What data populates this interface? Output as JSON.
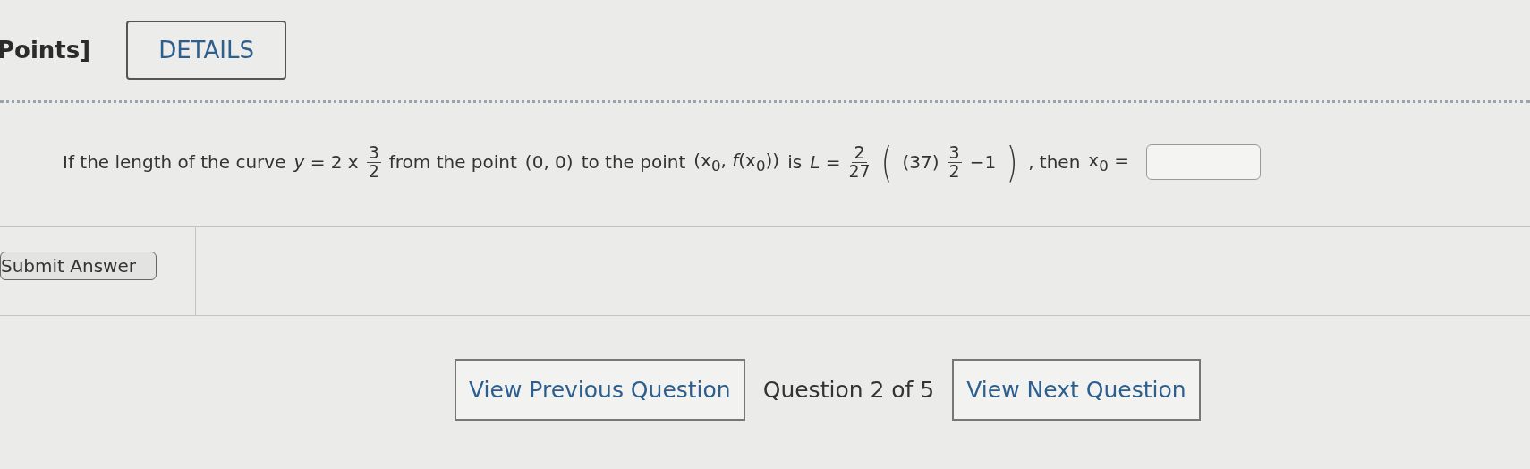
{
  "header": {
    "points_label": "Points]",
    "details_button": "DETAILS"
  },
  "question": [
    {
      "kind": "text",
      "text": "If the length of the curve"
    },
    {
      "kind": "math",
      "text": "*y* =  2 x"
    },
    {
      "kind": "frac",
      "num": "3",
      "den": "2"
    },
    {
      "kind": "text",
      "text": "from the point"
    },
    {
      "kind": "math",
      "text": "(0, 0)"
    },
    {
      "kind": "text",
      "text": "to the point"
    },
    {
      "kind": "math",
      "text": "(x$_{0}$, *f*(x$_{0}$))"
    },
    {
      "kind": "text",
      "text": "is"
    },
    {
      "kind": "math",
      "text": "*L* ="
    },
    {
      "kind": "frac",
      "num": "2",
      "den": "27"
    },
    {
      "kind": "paren",
      "text": "("
    },
    {
      "kind": "math",
      "text": "(37)"
    },
    {
      "kind": "frac",
      "num": "3",
      "den": "2"
    },
    {
      "kind": "math",
      "text": "−1"
    },
    {
      "kind": "paren",
      "text": ")"
    },
    {
      "kind": "text",
      "text": ", then"
    },
    {
      "kind": "math",
      "text": "x$_{0}$ ="
    },
    {
      "kind": "input"
    }
  ],
  "submit_button": "Submit Answer",
  "nav": {
    "previous_button": "View Previous Question",
    "position": "Question 2 of 5",
    "next_button": "View Next Question"
  }
}
